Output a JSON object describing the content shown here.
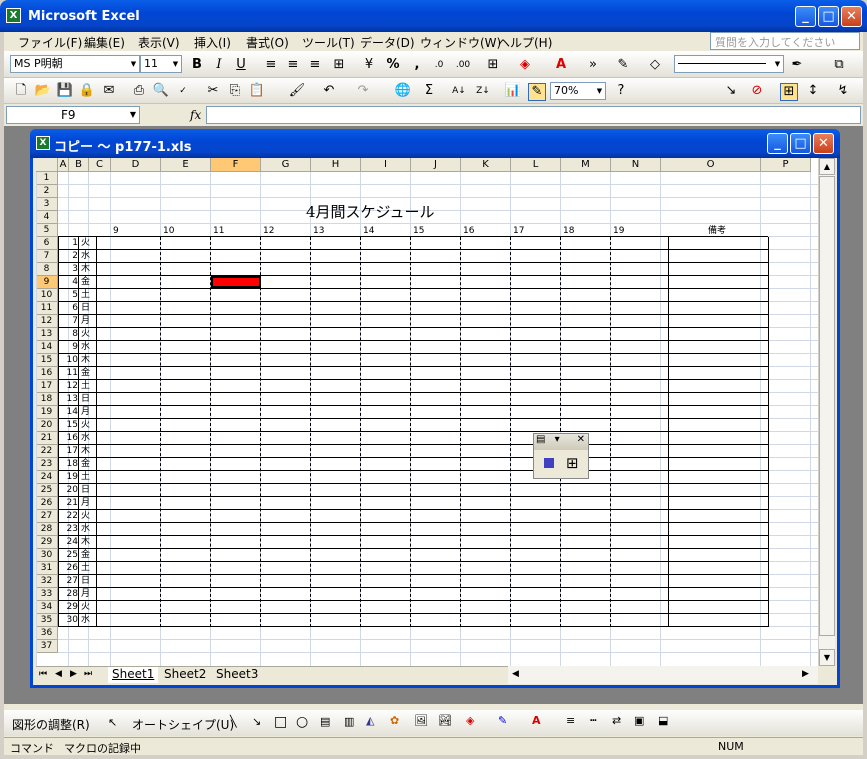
{
  "app_title": "Microsoft Excel",
  "menu": [
    "ファイル(F)",
    "編集(E)",
    "表示(V)",
    "挿入(I)",
    "書式(O)",
    "ツール(T)",
    "データ(D)",
    "ウィンドウ(W)",
    "ヘルプ(H)"
  ],
  "help_placeholder": "質問を入力してください",
  "font_name": "MS P明朝",
  "font_size": "11",
  "zoom": "70%",
  "name_box": "F9",
  "fx_label": "fx",
  "workbook_title": "コピー 〜 p177-1.xls",
  "columns": [
    "A",
    "B",
    "C",
    "D",
    "E",
    "F",
    "G",
    "H",
    "I",
    "J",
    "K",
    "L",
    "M",
    "N",
    "O",
    "P"
  ],
  "selected_col": "F",
  "selected_row": 9,
  "rows": [
    1,
    2,
    3,
    4,
    5,
    6,
    7,
    8,
    9,
    10,
    11,
    12,
    13,
    14,
    15,
    16,
    17,
    18,
    19,
    20,
    21,
    22,
    23,
    24,
    25,
    26,
    27,
    28,
    29,
    30,
    31,
    32,
    33,
    34,
    35,
    36,
    37
  ],
  "sheet_title": "4月間スケジュール",
  "hours": [
    "9",
    "10",
    "11",
    "12",
    "13",
    "14",
    "15",
    "16",
    "17",
    "18",
    "19"
  ],
  "remarks_label": "備考",
  "days": [
    [
      "1",
      "火"
    ],
    [
      "2",
      "水"
    ],
    [
      "3",
      "木"
    ],
    [
      "4",
      "金"
    ],
    [
      "5",
      "土"
    ],
    [
      "6",
      "日"
    ],
    [
      "7",
      "月"
    ],
    [
      "8",
      "火"
    ],
    [
      "9",
      "水"
    ],
    [
      "10",
      "木"
    ],
    [
      "11",
      "金"
    ],
    [
      "12",
      "土"
    ],
    [
      "13",
      "日"
    ],
    [
      "14",
      "月"
    ],
    [
      "15",
      "火"
    ],
    [
      "16",
      "水"
    ],
    [
      "17",
      "木"
    ],
    [
      "18",
      "金"
    ],
    [
      "19",
      "土"
    ],
    [
      "20",
      "日"
    ],
    [
      "21",
      "月"
    ],
    [
      "22",
      "火"
    ],
    [
      "23",
      "水"
    ],
    [
      "24",
      "木"
    ],
    [
      "25",
      "金"
    ],
    [
      "26",
      "土"
    ],
    [
      "27",
      "日"
    ],
    [
      "28",
      "月"
    ],
    [
      "29",
      "火"
    ],
    [
      "30",
      "水"
    ]
  ],
  "sheets": [
    "Sheet1",
    "Sheet2",
    "Sheet3"
  ],
  "highlight_color": "#ff0000",
  "drawing": {
    "adjust": "図形の調整(R)",
    "autoshape": "オートシェイプ(U)"
  },
  "status": {
    "mode": "コマンド",
    "macro": "マクロの記録中",
    "num": "NUM"
  }
}
